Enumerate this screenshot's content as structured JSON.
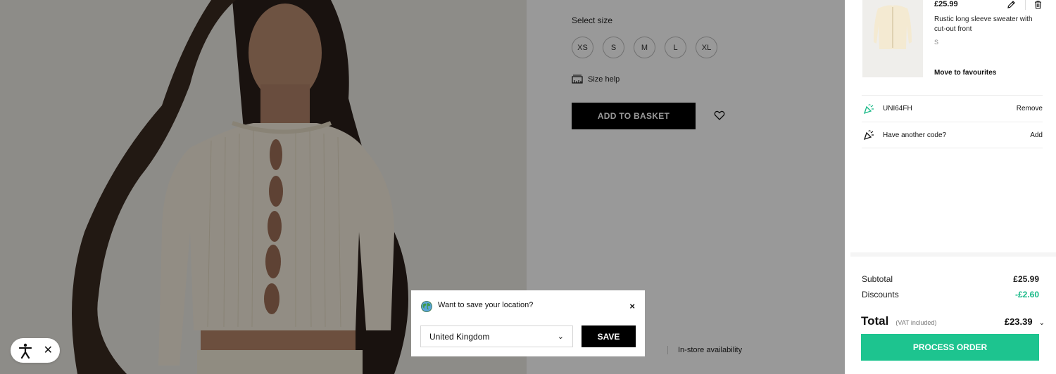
{
  "product": {
    "select_size_label": "Select size",
    "sizes": [
      "XS",
      "S",
      "M",
      "L",
      "XL"
    ],
    "size_help_label": "Size help",
    "add_to_basket_label": "ADD TO BASKET",
    "instore_label": "In-store availability"
  },
  "location_popup": {
    "title": "Want to save your location?",
    "close_label": "×",
    "selected_country": "United Kingdom",
    "save_label": "SAVE"
  },
  "accessibility": {
    "close_label": "✕"
  },
  "basket": {
    "item": {
      "price": "£25.99",
      "name": "Rustic long sleeve sweater with cut-out front",
      "size": "S",
      "move_label": "Move to favourites"
    },
    "applied_code": {
      "code": "UNI64FH",
      "action": "Remove"
    },
    "another_code": {
      "label": "Have another code?",
      "action": "Add"
    },
    "summary": {
      "subtotal_label": "Subtotal",
      "subtotal_value": "£25.99",
      "discounts_label": "Discounts",
      "discounts_value": "-£2.60",
      "total_label": "Total",
      "vat_label": "(VAT included)",
      "total_value": "£23.39",
      "process_label": "PROCESS ORDER"
    }
  },
  "colors": {
    "accent_green": "#1dc48f",
    "discount_green": "#14b885"
  }
}
